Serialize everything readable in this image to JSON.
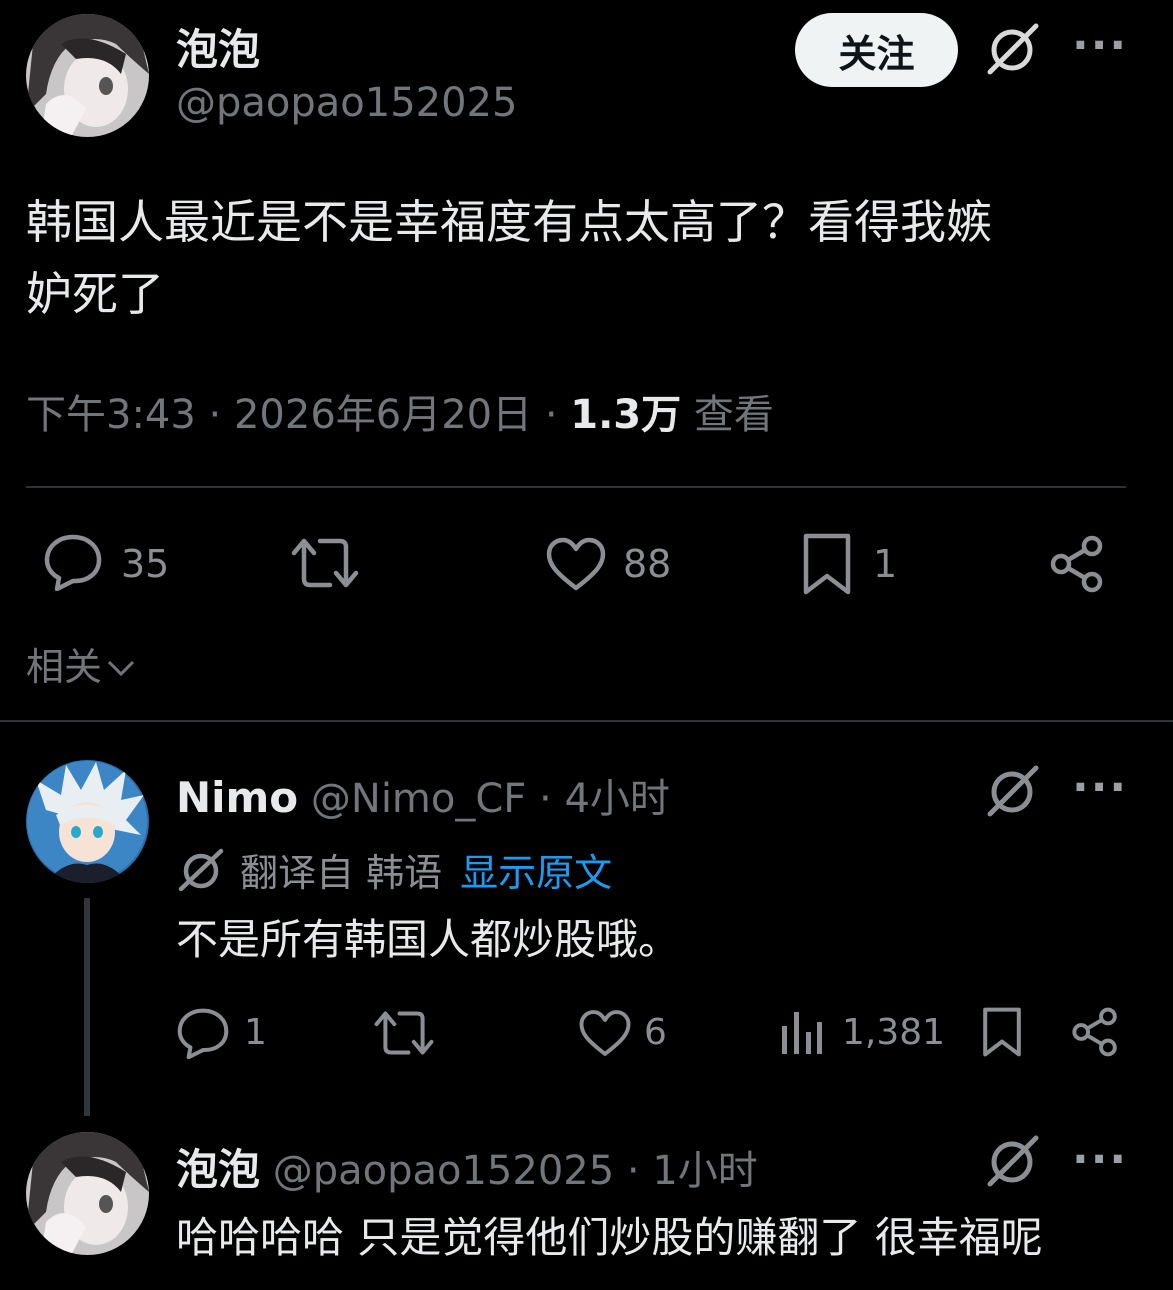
{
  "main_post": {
    "author_name": "泡泡",
    "handle": "@paopao152025",
    "follow_label": "关注",
    "text_line1": "韩国人最近是不是幸福度有点太高了？看得我嫉",
    "text_line2": "妒死了",
    "time": "下午3:43 · 2026年6月20日 · ",
    "views_count": "1.3万",
    "views_label": " 查看",
    "reply_count": "35",
    "like_count": "88",
    "bookmark_count": "1",
    "related_label": "相关"
  },
  "reply1": {
    "author_name": "Nimo",
    "handle_time": "@Nimo_CF · 4小时",
    "translated_label": "翻译自 韩语",
    "show_original": "显示原文",
    "text": "不是所有韩国人都炒股哦。",
    "reply_count": "1",
    "like_count": "6",
    "view_count": "1,381"
  },
  "reply2": {
    "author_name": "泡泡",
    "handle_time": "@paopao152025 · 1小时",
    "text": "哈哈哈哈 只是觉得他们炒股的赚翻了 很幸福呢"
  },
  "colors": {
    "background": "#000000",
    "text": "#e7e9ea",
    "muted": "#71767b",
    "link": "#1d9bf0",
    "divider": "#2f3336"
  },
  "icons": [
    "grok-icon",
    "more-icon",
    "reply-icon",
    "retweet-icon",
    "like-icon",
    "bookmark-icon",
    "share-icon",
    "views-icon",
    "translate-icon",
    "chevron-down-icon"
  ]
}
